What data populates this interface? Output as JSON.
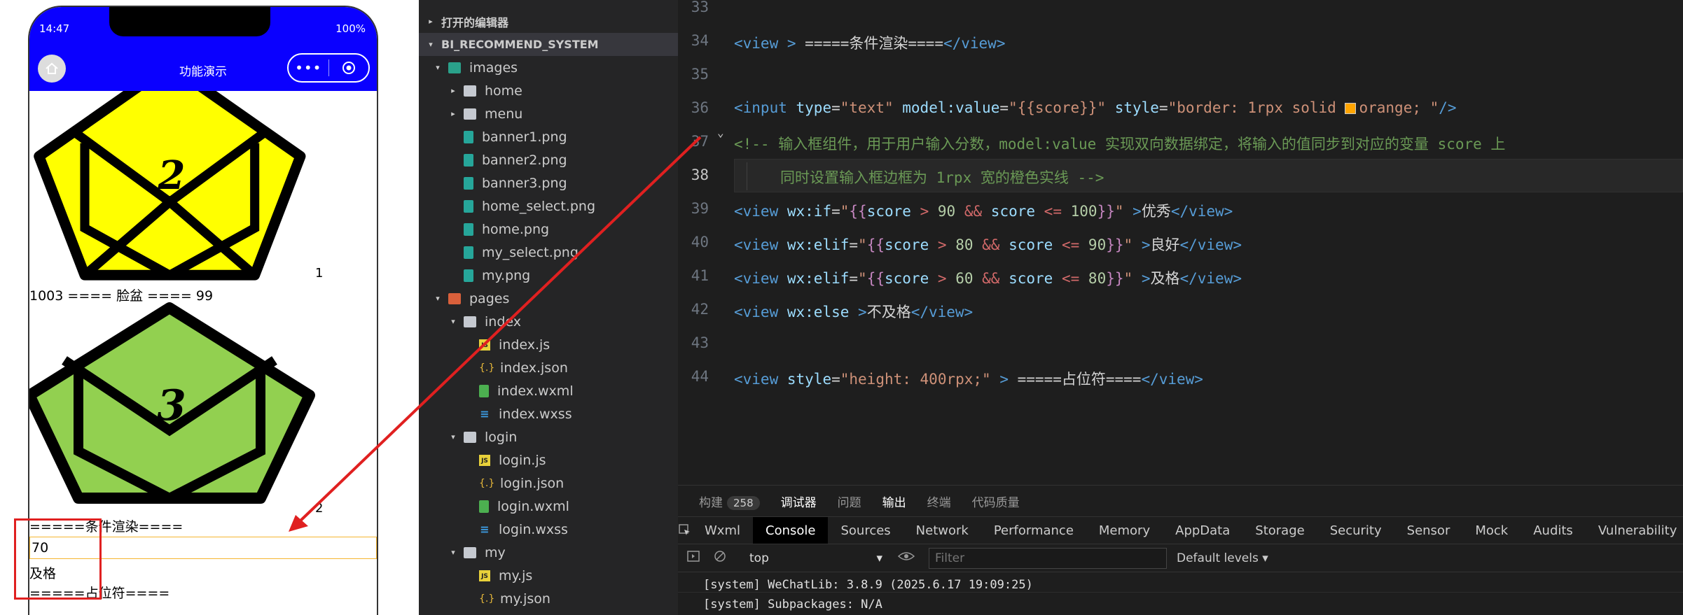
{
  "simulator": {
    "status_time": "14:47",
    "battery": "100%",
    "nav_title": "功能演示",
    "capsule_dots": "•••",
    "items": [
      {
        "pentagon_number": "2",
        "color": "#ffff00",
        "rank_label": "1",
        "caption": "1003 ==== 脸盆 ==== 99"
      },
      {
        "pentagon_number": "3",
        "color": "#92d050",
        "rank_label": "2"
      }
    ],
    "section_heading": "=====条件渲染====",
    "score_value": "70",
    "result_text": "及格",
    "placeholder_text": "=====占位符===="
  },
  "explorer": {
    "open_editors": "打开的编辑器",
    "project": "BI_RECOMMEND_SYSTEM",
    "rows": [
      {
        "label": "images",
        "icon": "folder-images-icon",
        "depth": 1,
        "twisty": "▾"
      },
      {
        "label": "home",
        "icon": "folder-icon",
        "depth": 2,
        "twisty": "▸"
      },
      {
        "label": "menu",
        "icon": "folder-icon",
        "depth": 2,
        "twisty": "▸"
      },
      {
        "label": "banner1.png",
        "icon": "png-icon",
        "depth": 2,
        "twisty": ""
      },
      {
        "label": "banner2.png",
        "icon": "png-icon",
        "depth": 2,
        "twisty": ""
      },
      {
        "label": "banner3.png",
        "icon": "png-icon",
        "depth": 2,
        "twisty": ""
      },
      {
        "label": "home_select.png",
        "icon": "png-icon",
        "depth": 2,
        "twisty": ""
      },
      {
        "label": "home.png",
        "icon": "png-icon",
        "depth": 2,
        "twisty": ""
      },
      {
        "label": "my_select.png",
        "icon": "png-icon",
        "depth": 2,
        "twisty": ""
      },
      {
        "label": "my.png",
        "icon": "png-icon",
        "depth": 2,
        "twisty": ""
      },
      {
        "label": "pages",
        "icon": "folder-pages-icon",
        "depth": 1,
        "twisty": "▾"
      },
      {
        "label": "index",
        "icon": "folder-icon",
        "depth": 2,
        "twisty": "▾"
      },
      {
        "label": "index.js",
        "icon": "js-icon",
        "depth": 3,
        "twisty": ""
      },
      {
        "label": "index.json",
        "icon": "json-icon",
        "depth": 3,
        "twisty": ""
      },
      {
        "label": "index.wxml",
        "icon": "wxml-icon",
        "depth": 3,
        "twisty": ""
      },
      {
        "label": "index.wxss",
        "icon": "wxss-icon",
        "depth": 3,
        "twisty": ""
      },
      {
        "label": "login",
        "icon": "folder-icon",
        "depth": 2,
        "twisty": "▾"
      },
      {
        "label": "login.js",
        "icon": "js-icon",
        "depth": 3,
        "twisty": ""
      },
      {
        "label": "login.json",
        "icon": "json-icon",
        "depth": 3,
        "twisty": ""
      },
      {
        "label": "login.wxml",
        "icon": "wxml-icon",
        "depth": 3,
        "twisty": ""
      },
      {
        "label": "login.wxss",
        "icon": "wxss-icon",
        "depth": 3,
        "twisty": ""
      },
      {
        "label": "my",
        "icon": "folder-icon",
        "depth": 2,
        "twisty": "▾"
      },
      {
        "label": "my.js",
        "icon": "js-icon",
        "depth": 3,
        "twisty": ""
      },
      {
        "label": "my.json",
        "icon": "json-icon",
        "depth": 3,
        "twisty": ""
      }
    ]
  },
  "editor": {
    "line_numbers": [
      "33",
      "34",
      "35",
      "36",
      "37",
      "38",
      "39",
      "40",
      "41",
      "42",
      "43",
      "44"
    ],
    "current_line": "38"
  },
  "panel": {
    "top_tabs": [
      "构建",
      "调试器",
      "问题",
      "输出",
      "终端",
      "代码质量"
    ],
    "build_count": "258",
    "devtools_tabs": [
      "Wxml",
      "Console",
      "Sources",
      "Network",
      "Performance",
      "Memory",
      "AppData",
      "Storage",
      "Security",
      "Sensor",
      "Mock",
      "Audits",
      "Vulnerability"
    ],
    "context": "top",
    "filter_placeholder": "Filter",
    "levels": "Default levels ▾",
    "logs": [
      "[system] WeChatLib: 3.8.9 (2025.6.17 19:09:25)",
      "[system] Subpackages: N/A"
    ]
  },
  "colors": {
    "nav_blue": "#0a00ff",
    "input_border": "orange",
    "annotation_red": "#e02020"
  }
}
